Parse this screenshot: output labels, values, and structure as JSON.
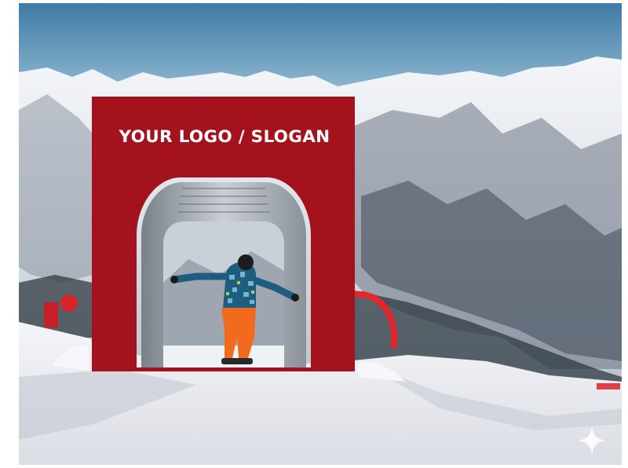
{
  "banner": {
    "slogan_text": "YOUR LOGO / SLOGAN",
    "color": "#A4121D"
  },
  "scene": {
    "sky_color": "#4F88AE",
    "snow_color": "#EEF0F4",
    "jacket_color": "#1E5D7E",
    "pants_color": "#F26A1B"
  },
  "icons": {
    "corner_mark": "sparkle-icon"
  }
}
